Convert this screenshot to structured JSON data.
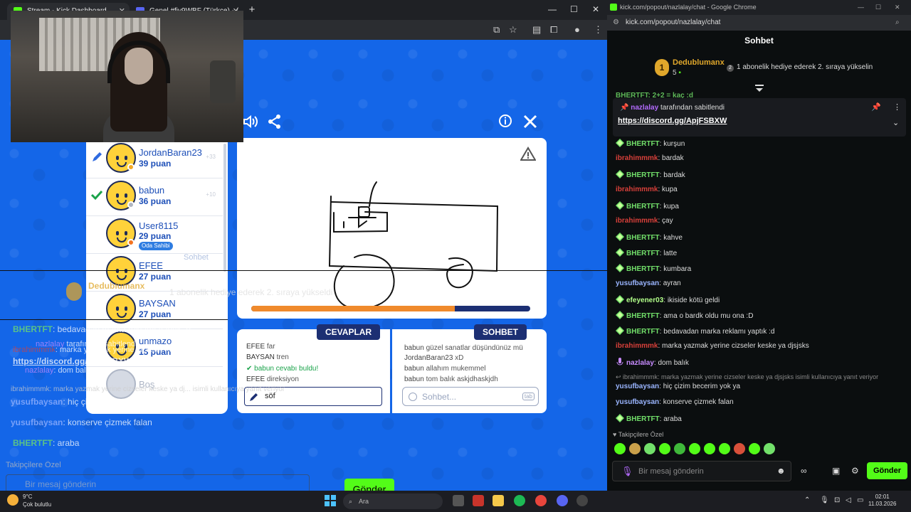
{
  "left_window": {
    "tabs": [
      {
        "label": "Stream - Kick Dashboard",
        "color": "#53fc18"
      },
      {
        "label": "Genel #fiy9WBF (Türkçe) - (",
        "color": "#5865f2"
      }
    ]
  },
  "game": {
    "players": [
      {
        "name": "JordanBaran23",
        "score": "39 puan",
        "status": "pencil",
        "rank": "+33",
        "dot": "#f3a825"
      },
      {
        "name": "babun",
        "score": "36 puan",
        "status": "check",
        "rank": "+10",
        "dot": "#b0b6c2"
      },
      {
        "name": "User8115",
        "score": "29 puan",
        "status": "",
        "rank": "",
        "dot": "#f37321",
        "badge": "Oda Sahibi"
      },
      {
        "name": "EFEE",
        "score": "27 puan",
        "status": "",
        "rank": "",
        "dot": ""
      },
      {
        "name": "BAYSAN",
        "score": "27 puan",
        "status": "",
        "rank": "",
        "dot": ""
      },
      {
        "name": "unmazo",
        "score": "15 puan",
        "status": "",
        "rank": "",
        "dot": ""
      }
    ],
    "empty_slot": "Boş",
    "answers_title": "CEVAPLAR",
    "chat_title": "SOHBET",
    "answers": [
      {
        "user": "EFEE",
        "text": "far"
      },
      {
        "user": "BAYSAN",
        "text": "tren"
      },
      {
        "user": "babun",
        "text": "cevabı buldu!",
        "correct": true
      },
      {
        "user": "EFEE",
        "text": "direksiyon"
      }
    ],
    "chat": [
      {
        "user": "babun",
        "text": "güzel sanatlar düşündünüz mü"
      },
      {
        "user": "JordanBaran23",
        "text": "xD"
      },
      {
        "user": "babun",
        "text": "allahım mukemmel"
      },
      {
        "user": "babun",
        "text": "tom balık askjdhaskjdh"
      }
    ],
    "answer_value": "söf",
    "chat_placeholder": "Sohbet...",
    "tab_key": "tab",
    "timer_progress": 0.73
  },
  "ghost": {
    "leader_name": "Dedublumanx",
    "leader_count": "5",
    "leader_msg": "1 abonelik hediye ederek 2. sıraya yükseldi",
    "lines": [
      {
        "user": "BHERTFT",
        "text": "bedavadan marka reklamı yaptık :d"
      },
      {
        "user": "nazlalay",
        "text": "tarafından sabitlendi"
      },
      {
        "user": "ibrahimmmk",
        "text": "marka yazmak yerine cizseler keske ya dj"
      },
      {
        "user": "",
        "text": "https://discord.gg/ApjFSBXW"
      },
      {
        "user": "nazlalay",
        "text": "dom balık"
      },
      {
        "user": "ibrahimmmk",
        "text": "marka yazmak yerine cizseler keske ya dj... isimli kullanıcıya yanıt veriyor"
      },
      {
        "user": "yusufbaysan",
        "text": "hiç çizim becerim yok ya"
      },
      {
        "user": "yusufbaysan",
        "text": "konserve çizmek falan"
      },
      {
        "user": "BHERTFT",
        "text": "araba"
      }
    ],
    "followers": "Takipçilere Özel",
    "input_ph": "Bir mesaj gönderin",
    "send": "Gönder",
    "sohbet_label": "Sohbet"
  },
  "right_window": {
    "title": "kick.com/popout/nazlalay/chat - Google Chrome",
    "url": "kick.com/popout/nazlalay/chat",
    "header": "Sohbet",
    "leader_name": "Dedublumanx",
    "leader_count": "5",
    "leader_msg": "1 abonelik hediye ederek 2. sıraya yükselin",
    "pinned_user": "nazlalay",
    "pinned_label": "tarafından sabitlendi",
    "pinned_link": "https://discord.gg/ApjFSBXW",
    "partial_top": "BHERTFT: 2+2 = kaç :d",
    "messages": [
      {
        "user": "BHERTFT",
        "text": "kurşun",
        "c": "g",
        "gem": true
      },
      {
        "user": "ibrahimmmk",
        "text": "bardak",
        "c": "r"
      },
      {
        "user": "BHERTFT",
        "text": "bardak",
        "c": "g",
        "gem": true
      },
      {
        "user": "ibrahimmmk",
        "text": "kupa",
        "c": "r"
      },
      {
        "user": "BHERTFT",
        "text": "kupa",
        "c": "g",
        "gem": true
      },
      {
        "user": "ibrahimmmk",
        "text": "çay",
        "c": "r"
      },
      {
        "user": "BHERTFT",
        "text": "kahve",
        "c": "g",
        "gem": true
      },
      {
        "user": "BHERTFT",
        "text": "latte",
        "c": "g",
        "gem": true
      },
      {
        "user": "BHERTFT",
        "text": "kumbara",
        "c": "g",
        "gem": true
      },
      {
        "user": "yusufbaysan",
        "text": "ayran",
        "c": "b"
      },
      {
        "user": "efeyener03",
        "text": "ikiside kötü geldi",
        "c": "l",
        "gem": true
      },
      {
        "user": "BHERTFT",
        "text": "ama o bardk oldu mu ona :D",
        "c": "g",
        "gem": true
      },
      {
        "user": "BHERTFT",
        "text": "bedavadan marka reklamı yaptık :d",
        "c": "g",
        "gem": true
      },
      {
        "user": "ibrahimmmk",
        "text": "marka yazmak yerine cizseler keske ya djsjsks",
        "c": "r"
      },
      {
        "user": "nazlalay",
        "text": "dom balık",
        "c": "p",
        "mic": true
      }
    ],
    "reply_note": "ibrahimmmk: marka yazmak yerine cizseler keske ya djsjsks isimli kullanıcıya yanıt veriyor",
    "messages2": [
      {
        "user": "yusufbaysan",
        "text": "hiç çizim becerim yok ya",
        "c": "b"
      },
      {
        "user": "yusufbaysan",
        "text": "konserve çizmek falan",
        "c": "b"
      },
      {
        "user": "BHERTFT",
        "text": "araba",
        "c": "g",
        "gem": true
      }
    ],
    "followers_label": "Takipçilere Özel",
    "input_placeholder": "Bir mesaj gönderin",
    "send_label": "Gönder"
  },
  "taskbar": {
    "temp": "9°C",
    "weather": "Çok bulutlu",
    "search": "Ara",
    "time": "02:01",
    "date": "11.03.2026"
  }
}
